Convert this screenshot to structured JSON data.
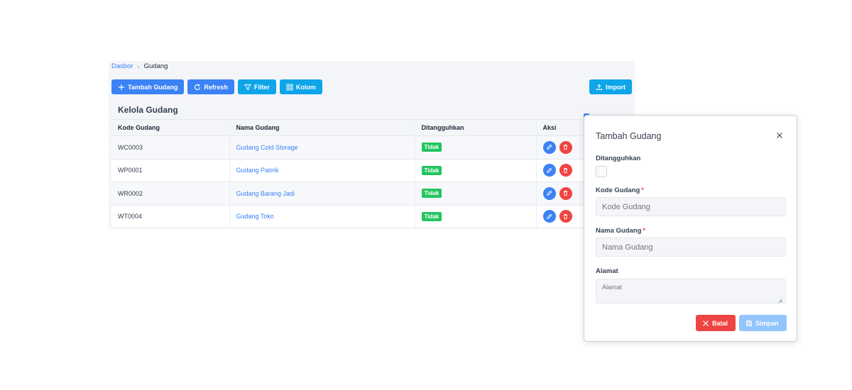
{
  "breadcrumb": {
    "parent": "Dasbor",
    "separator": "›",
    "current": "Gudang"
  },
  "toolbar": {
    "add_label": "Tambah Gudang",
    "refresh_label": "Refresh",
    "filter_label": "Filter",
    "columns_label": "Kolom",
    "import_label": "Import"
  },
  "card": {
    "title": "Kelola Gudang"
  },
  "table": {
    "headers": [
      "Kode Gudang",
      "Nama Gudang",
      "Ditangguhkan",
      "Aksi"
    ],
    "rows": [
      {
        "code": "WC0003",
        "name": "Gudang Cold Storage",
        "suspended": "Tidak"
      },
      {
        "code": "WP0001",
        "name": "Gudang Pabrik",
        "suspended": "Tidak"
      },
      {
        "code": "WR0002",
        "name": "Gudang Barang Jadi",
        "suspended": "Tidak"
      },
      {
        "code": "WT0004",
        "name": "Gudang Toko",
        "suspended": "Tidak"
      }
    ]
  },
  "dialog": {
    "title": "Tambah Gudang",
    "suspended_label": "Ditangguhkan",
    "code_label": "Kode Gudang",
    "code_placeholder": "Kode Gudang",
    "name_label": "Nama Gudang",
    "name_placeholder": "Nama Gudang",
    "address_label": "Alamat",
    "address_placeholder": "Alamat",
    "required_mark": "*",
    "cancel_label": "Batal",
    "save_label": "Simpan"
  },
  "colors": {
    "primary": "#3b82f6",
    "sky": "#0ea5e9",
    "success": "#22c55e",
    "danger": "#ef4444",
    "disabled": "#93c5fd"
  },
  "icons": [
    "plus-icon",
    "refresh-icon",
    "filter-icon",
    "columns-icon",
    "upload-icon",
    "pencil-icon",
    "trash-icon",
    "close-icon",
    "save-icon"
  ]
}
